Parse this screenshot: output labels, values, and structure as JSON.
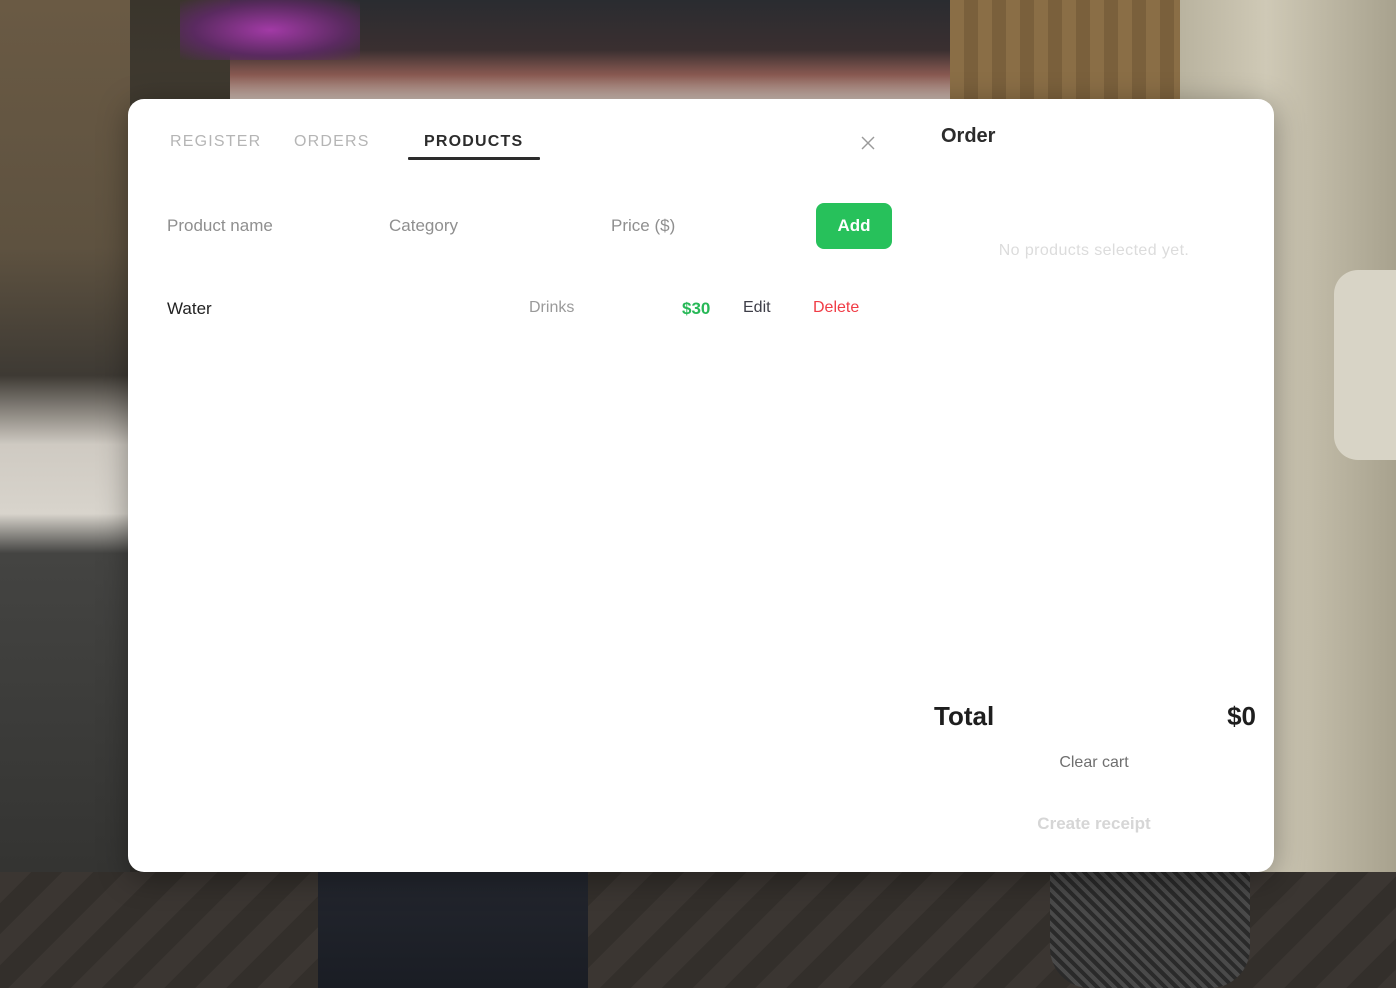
{
  "tabs": [
    {
      "label": "REGISTER",
      "active": false
    },
    {
      "label": "ORDERS",
      "active": false
    },
    {
      "label": "PRODUCTS",
      "active": true
    }
  ],
  "form": {
    "name_placeholder": "Product name",
    "category_placeholder": "Category",
    "price_placeholder": "Price ($)",
    "add_label": "Add"
  },
  "products": [
    {
      "name": "Water",
      "category": "Drinks",
      "price": "$30",
      "edit_label": "Edit",
      "delete_label": "Delete"
    }
  ],
  "order": {
    "title": "Order",
    "empty_message": "No products selected yet.",
    "total_label": "Total",
    "total_value": "$0",
    "clear_label": "Clear cart",
    "receipt_label": "Create receipt"
  },
  "colors": {
    "accent_green": "#27c15b",
    "delete_red": "#f03c46",
    "price_green": "#27b857"
  },
  "icons": {
    "close": "close-icon"
  }
}
